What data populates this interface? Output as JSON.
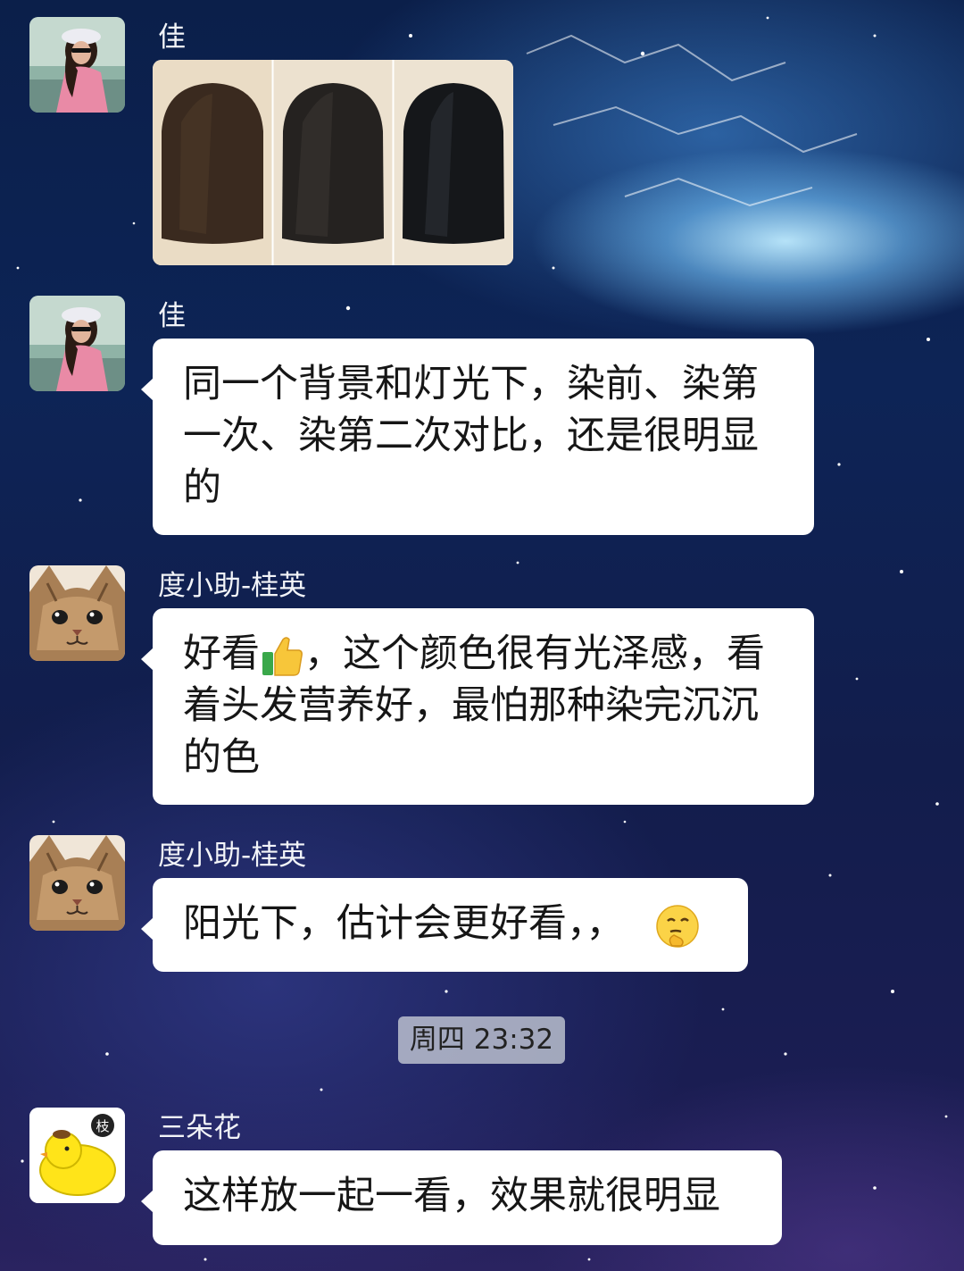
{
  "messages": [
    {
      "sender": "佳",
      "type": "image",
      "image_alt": ""
    },
    {
      "sender": "佳",
      "lines": [
        "同一个背景和灯光下，染前、染第",
        "一次、染第二次对比，还是很明显",
        "的"
      ]
    },
    {
      "sender": "度小助-桂英",
      "lines": [
        "好看",
        "，这个颜色很有光泽感，看",
        "着头发营养好，最怕那种染完沉沉",
        "的色"
      ],
      "emoji": "thumbs-up-icon"
    },
    {
      "sender": "度小助-桂英",
      "text": "阳光下，估计会更好看，，",
      "emoji": "thinking-face-icon"
    },
    {
      "sender": "三朵花",
      "text": "这样放一起一看，效果就很明显"
    }
  ],
  "timestamp": "周四 23:32",
  "avatar_badge": "枝",
  "colors": {
    "bubble": "#ffffff",
    "sender_text": "#f2f4f8",
    "timestamp_bg": "#c8cdd7"
  }
}
